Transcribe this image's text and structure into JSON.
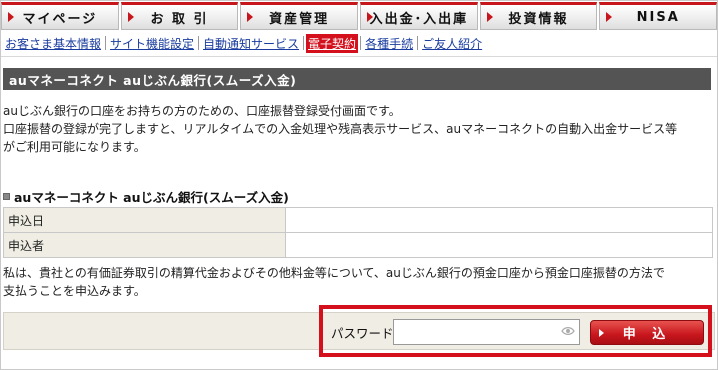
{
  "top_nav": [
    {
      "label": "マイページ",
      "icon": "arrow-right-icon"
    },
    {
      "label": "お 取 引",
      "icon": "arrow-right-icon"
    },
    {
      "label": "資産管理",
      "icon": "arrow-right-icon"
    },
    {
      "label": "入出金･入出庫",
      "icon": "arrow-right-icon"
    },
    {
      "label": "投資情報",
      "icon": "arrow-right-icon"
    },
    {
      "label": "NISA",
      "icon": "arrow-right-icon"
    }
  ],
  "sub_nav": [
    {
      "label": "お客さま基本情報",
      "active": false
    },
    {
      "label": "サイト機能設定",
      "active": false
    },
    {
      "label": "自動通知サービス",
      "active": false
    },
    {
      "label": "電子契約",
      "active": true
    },
    {
      "label": "各種手続",
      "active": false
    },
    {
      "label": "ご友人紹介",
      "active": false
    }
  ],
  "section_title": "auマネーコネクト auじぶん銀行(スムーズ入金)",
  "intro_lines": [
    "auじぶん銀行の口座をお持ちの方のための、口座振替登録受付画面です。",
    "口座振替の登録が完了しますと、リアルタイムでの入金処理や残高表示サービス、auマネーコネクトの自動入出金サービス等",
    "がご利用可能になります。"
  ],
  "form_title": "auマネーコネクト auじぶん銀行(スムーズ入金)",
  "form_rows": [
    {
      "label": "申込日",
      "value": ""
    },
    {
      "label": "申込者",
      "value": ""
    }
  ],
  "agreement_lines": [
    "私は、貴社との有価証券取引の精算代金およびその他料金等について、auじぶん銀行の預金口座から預金口座振替の方法で",
    "支払うことを申込みます。"
  ],
  "password": {
    "label": "パスワード",
    "value": "",
    "placeholder": "",
    "toggle_icon": "eye-icon"
  },
  "submit_label": "申 込",
  "colors": {
    "accent": "#c8161d",
    "title_bar": "#545454",
    "label_bg": "#efede4",
    "link": "#1a3c9e"
  }
}
